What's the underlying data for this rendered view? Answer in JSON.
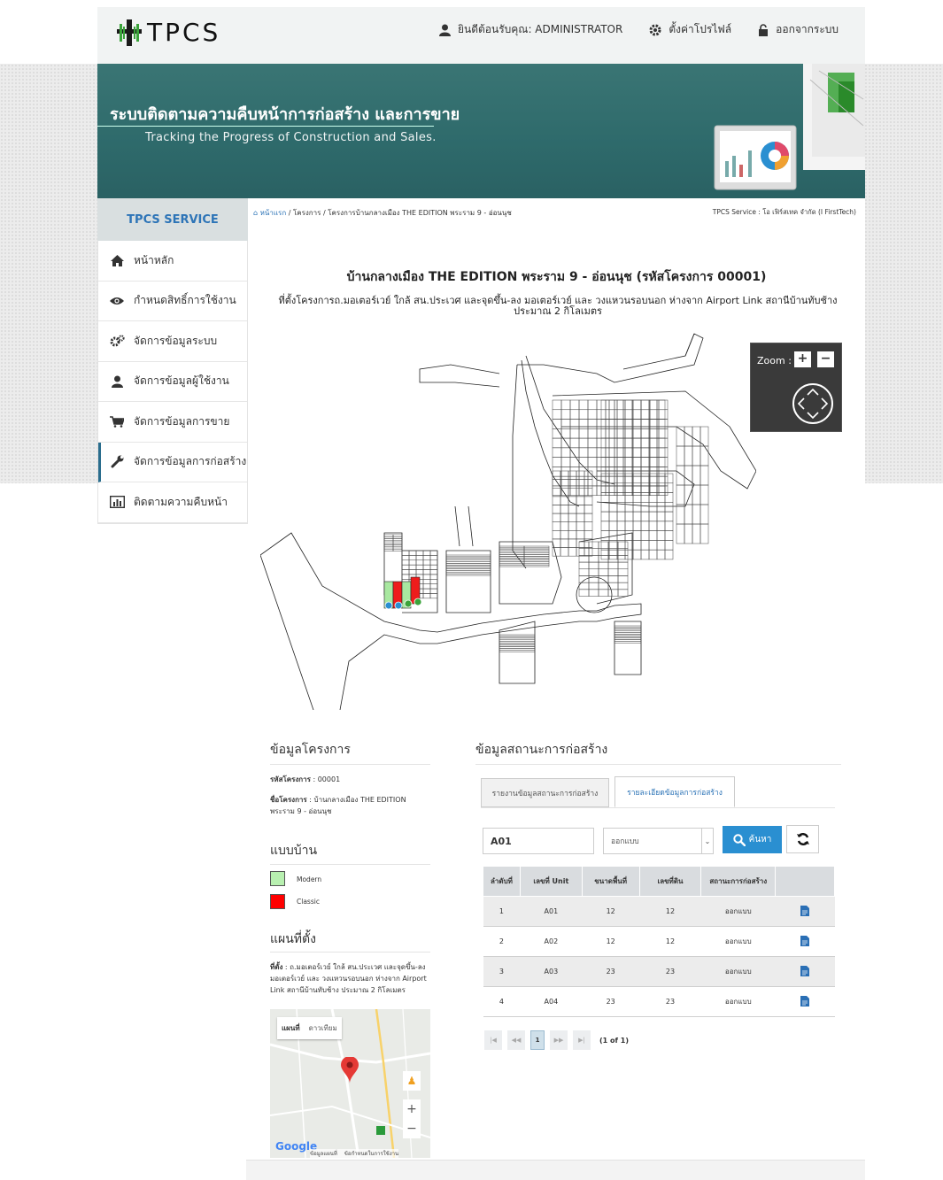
{
  "app": {
    "logo_text": "TPCS"
  },
  "topnav": {
    "welcome": "ยินดีต้อนรับคุณ: ADMINISTRATOR",
    "profile": "ตั้งค่าโปรไฟล์",
    "logout": "ออกจากระบบ"
  },
  "banner": {
    "title": "ระบบติดตามความคืบหน้าการก่อสร้าง และการขาย",
    "subtitle": "Tracking the Progress of Construction and Sales."
  },
  "sidebar": {
    "service_title": "TPCS SERVICE",
    "items": [
      {
        "label": "หน้าหลัก",
        "icon": "home-icon"
      },
      {
        "label": "กำหนดสิทธิ์การใช้งาน",
        "icon": "eye-icon"
      },
      {
        "label": "จัดการข้อมูลระบบ",
        "icon": "gears-icon"
      },
      {
        "label": "จัดการข้อมูลผู้ใช้งาน",
        "icon": "user-icon"
      },
      {
        "label": "จัดการข้อมูลการขาย",
        "icon": "cart-icon"
      },
      {
        "label": "จัดการข้อมูลการก่อสร้าง",
        "icon": "wrench-icon"
      },
      {
        "label": "ติดตามความคืบหน้า",
        "icon": "chart-icon"
      }
    ]
  },
  "breadcrumb": {
    "home": "หน้าแรก",
    "trail": " / โครงการ / โครงการบ้านกลางเมือง THE EDITION พระราม 9 - อ่อนนุช",
    "right": "TPCS Service : โอ เฟิร์สเทค จำกัด (I FirstTech)"
  },
  "project": {
    "title": "บ้านกลางเมือง THE EDITION พระราม 9 - อ่อนนุช (รหัสโครงการ 00001)",
    "location": "ที่ตั้งโครงการถ.มอเตอร์เวย์ ใกล้ สน.ประเวศ และจุดขึ้น-ลง มอเตอร์เวย์ และ วงแหวนรอบนอก ห่างจาก Airport Link สถานีบ้านทับช้าง ประมาณ 2 กิโลเมตร"
  },
  "zoom": {
    "label": "Zoom :",
    "plus": "+",
    "minus": "−"
  },
  "project_info": {
    "heading": "ข้อมูลโครงการ",
    "code_label": "รหัสโครงการ",
    "code_value": " : 00001",
    "name_label": "ชื่อโครงการ",
    "name_value": " : บ้านกลางเมือง THE EDITION พระราม 9 - อ่อนนุช"
  },
  "house_types": {
    "heading": "แบบบ้าน",
    "items": [
      {
        "label": "Modern",
        "color": "#b8f0b0"
      },
      {
        "label": "Classic",
        "color": "#ff0000"
      }
    ]
  },
  "location_map": {
    "heading": "แผนที่ตั้ง",
    "label": "ที่ตั้ง",
    "text": " : ถ.มอเตอร์เวย์ ใกล้ สน.ประเวศ และจุดขึ้น-ลง มอเตอร์เวย์ และ วงแหวนรอบนอก ห่างจาก Airport Link สถานีบ้านทับช้าง ประมาณ 2 กิโลเมตร",
    "map_tab": "แผนที่",
    "sat_tab": "ดาวเทียม",
    "google": "Google",
    "map_data": "ข้อมูลแผนที่",
    "terms": "ข้อกำหนดในการใช้งาน"
  },
  "status": {
    "heading": "ข้อมูลสถานะการก่อสร้าง",
    "tabs": [
      "รายงานข้อมูลสถานะการก่อสร้าง",
      "รายละเอียดข้อมูลการก่อสร้าง"
    ],
    "search_value": "A01",
    "select_value": "ออกแบบ",
    "search_btn": "ค้นหา",
    "columns": [
      "ลำดับที่",
      "เลขที่ Unit",
      "ขนาดพื้นที่",
      "เลขที่ดิน",
      "สถานะการก่อสร้าง",
      ""
    ],
    "rows": [
      {
        "no": "1",
        "unit": "A01",
        "area": "12",
        "land": "12",
        "status": "ออกแบบ"
      },
      {
        "no": "2",
        "unit": "A02",
        "area": "12",
        "land": "12",
        "status": "ออกแบบ"
      },
      {
        "no": "3",
        "unit": "A03",
        "area": "23",
        "land": "23",
        "status": "ออกแบบ"
      },
      {
        "no": "4",
        "unit": "A04",
        "area": "23",
        "land": "23",
        "status": "ออกแบบ"
      }
    ],
    "pager": {
      "first": "|◀",
      "prev": "◀◀",
      "page": "1",
      "next": "▶▶",
      "last": "▶|",
      "info": "(1 of 1)"
    }
  },
  "colors": {
    "accent": "#2a8fd1",
    "banner": "#2f6b6c",
    "sidebar_title": "#2d74b7"
  }
}
